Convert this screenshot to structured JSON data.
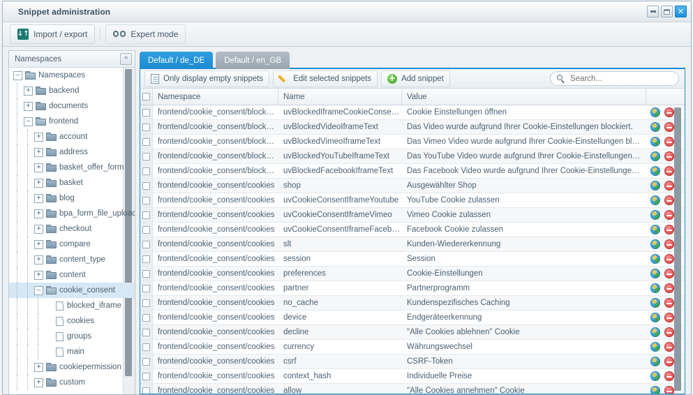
{
  "window": {
    "title": "Snippet administration",
    "controls": [
      {
        "name": "minimize-button",
        "glyph": "_"
      },
      {
        "name": "maximize-button",
        "glyph": "□"
      },
      {
        "name": "close-button",
        "glyph": "✕"
      }
    ]
  },
  "toolbar": {
    "import_export": "Import / export",
    "expert_mode": "Expert mode"
  },
  "sidebar": {
    "header": "Namespaces",
    "collapse_glyph": "«",
    "tree": [
      {
        "label": "Namespaces",
        "depth": 0,
        "type": "folder",
        "state": "open",
        "selected": false
      },
      {
        "label": "backend",
        "depth": 1,
        "type": "folder",
        "state": "closed",
        "selected": false
      },
      {
        "label": "documents",
        "depth": 1,
        "type": "folder",
        "state": "closed",
        "selected": false
      },
      {
        "label": "frontend",
        "depth": 1,
        "type": "folder",
        "state": "open",
        "selected": false
      },
      {
        "label": "account",
        "depth": 2,
        "type": "folder",
        "state": "closed",
        "selected": false
      },
      {
        "label": "address",
        "depth": 2,
        "type": "folder",
        "state": "closed",
        "selected": false
      },
      {
        "label": "basket_offer_form",
        "depth": 2,
        "type": "folder",
        "state": "closed",
        "selected": false
      },
      {
        "label": "basket",
        "depth": 2,
        "type": "folder",
        "state": "closed",
        "selected": false
      },
      {
        "label": "blog",
        "depth": 2,
        "type": "folder",
        "state": "closed",
        "selected": false
      },
      {
        "label": "bpa_form_file_upload",
        "depth": 2,
        "type": "folder",
        "state": "closed",
        "selected": false
      },
      {
        "label": "checkout",
        "depth": 2,
        "type": "folder",
        "state": "closed",
        "selected": false
      },
      {
        "label": "compare",
        "depth": 2,
        "type": "folder",
        "state": "closed",
        "selected": false
      },
      {
        "label": "content_type",
        "depth": 2,
        "type": "folder",
        "state": "closed",
        "selected": false
      },
      {
        "label": "content",
        "depth": 2,
        "type": "folder",
        "state": "closed",
        "selected": false
      },
      {
        "label": "cookie_consent",
        "depth": 2,
        "type": "folder",
        "state": "open",
        "selected": true
      },
      {
        "label": "blocked_iframe",
        "depth": 3,
        "type": "file",
        "state": "",
        "selected": false
      },
      {
        "label": "cookies",
        "depth": 3,
        "type": "file",
        "state": "",
        "selected": false
      },
      {
        "label": "groups",
        "depth": 3,
        "type": "file",
        "state": "",
        "selected": false
      },
      {
        "label": "main",
        "depth": 3,
        "type": "file",
        "state": "",
        "selected": false
      },
      {
        "label": "cookiepermission",
        "depth": 2,
        "type": "folder",
        "state": "closed",
        "selected": false
      },
      {
        "label": "custom",
        "depth": 2,
        "type": "folder",
        "state": "closed",
        "selected": false
      }
    ]
  },
  "tabs": [
    {
      "label": "Default / de_DE",
      "active": true
    },
    {
      "label": "Default / en_GB",
      "active": false
    }
  ],
  "grid_toolbar": {
    "only_empty": "Only display empty snippets",
    "edit_selected": "Edit selected snippets",
    "add_snippet": "Add snippet",
    "search_placeholder": "Search...",
    "search_value": ""
  },
  "grid": {
    "columns": [
      "Namespace",
      "Name",
      "Value"
    ],
    "rows": [
      {
        "namespace": "frontend/cookie_consent/block…",
        "name": "uvBlockedIframeCookieConse…",
        "value": "Cookie Einstellungen öffnen"
      },
      {
        "namespace": "frontend/cookie_consent/block…",
        "name": "uvBlockedVideoIframeText",
        "value": "Das Video wurde aufgrund Ihrer Cookie-Einstellungen blockiert."
      },
      {
        "namespace": "frontend/cookie_consent/block…",
        "name": "uvBlockedVimeoIframeText",
        "value": "Das Vimeo Video wurde aufgrund Ihrer Cookie-Einstellungen blocki…"
      },
      {
        "namespace": "frontend/cookie_consent/block…",
        "name": "uvBlockedYouTubeIframeText",
        "value": "Das YouTube Video wurde aufgrund Ihrer Cookie-Einstellungen blo…"
      },
      {
        "namespace": "frontend/cookie_consent/block…",
        "name": "uvBlockedFacebookIframeText",
        "value": "Das Facebook Video wurde aufgrund Ihrer Cookie-Einstellungen bl…"
      },
      {
        "namespace": "frontend/cookie_consent/cookies",
        "name": "shop",
        "value": "Ausgewählter Shop"
      },
      {
        "namespace": "frontend/cookie_consent/cookies",
        "name": "uvCookieConsentIframeYoutube",
        "value": "YouTube Cookie zulassen"
      },
      {
        "namespace": "frontend/cookie_consent/cookies",
        "name": "uvCookieConsentIframeVimeo",
        "value": "Vimeo Cookie zulassen"
      },
      {
        "namespace": "frontend/cookie_consent/cookies",
        "name": "uvCookieConsentIframeFaceb…",
        "value": "Facebook Cookie zulassen"
      },
      {
        "namespace": "frontend/cookie_consent/cookies",
        "name": "slt",
        "value": "Kunden-Wiedererkennung"
      },
      {
        "namespace": "frontend/cookie_consent/cookies",
        "name": "session",
        "value": "Session"
      },
      {
        "namespace": "frontend/cookie_consent/cookies",
        "name": "preferences",
        "value": "Cookie-Einstellungen"
      },
      {
        "namespace": "frontend/cookie_consent/cookies",
        "name": "partner",
        "value": "Partnerprogramm"
      },
      {
        "namespace": "frontend/cookie_consent/cookies",
        "name": "no_cache",
        "value": "Kundenspezifisches Caching"
      },
      {
        "namespace": "frontend/cookie_consent/cookies",
        "name": "device",
        "value": "Endgeräteerkennung"
      },
      {
        "namespace": "frontend/cookie_consent/cookies",
        "name": "decline",
        "value": "\"Alle Cookies ablehnen\" Cookie"
      },
      {
        "namespace": "frontend/cookie_consent/cookies",
        "name": "currency",
        "value": "Währungswechsel"
      },
      {
        "namespace": "frontend/cookie_consent/cookies",
        "name": "csrf",
        "value": "CSRF-Token"
      },
      {
        "namespace": "frontend/cookie_consent/cookies",
        "name": "context_hash",
        "value": "Individuelle Preise"
      },
      {
        "namespace": "frontend/cookie_consent/cookies",
        "name": "allow",
        "value": "\"Alle Cookies annehmen\" Cookie"
      }
    ]
  }
}
